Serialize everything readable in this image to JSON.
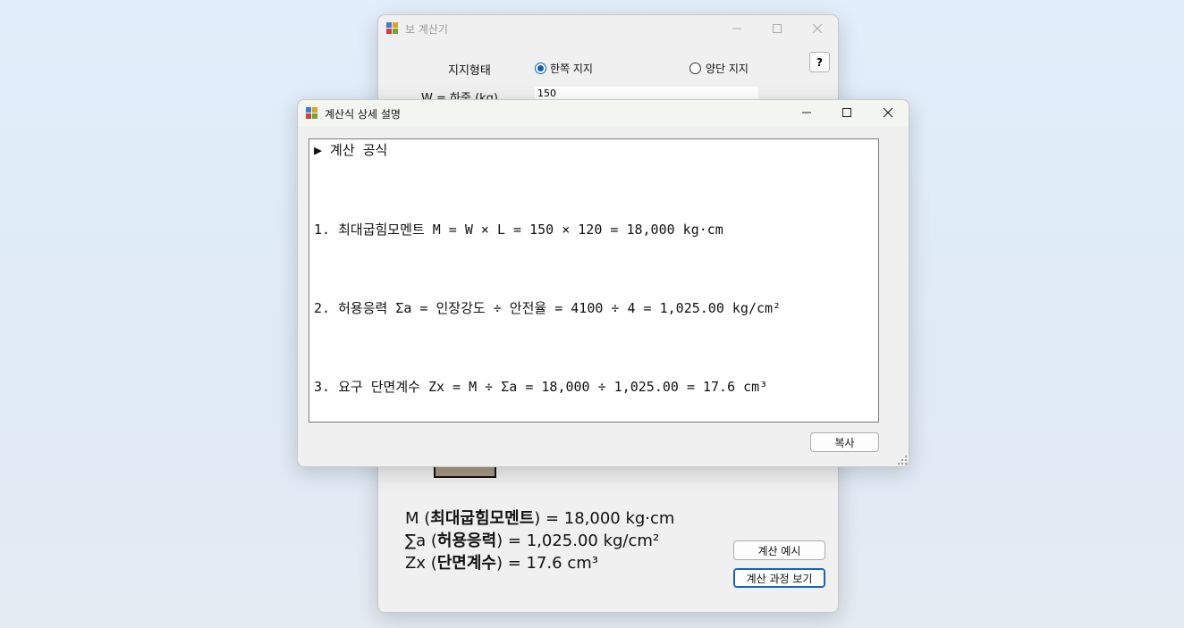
{
  "main_window": {
    "title": "보 계산기",
    "support_label": "지지형태",
    "radio_single": "한쪽 지지",
    "radio_double": "양단 지지",
    "help_label": "?",
    "load_label": "W = 하중 (kg)",
    "load_value": "150",
    "results": {
      "m_prefix": "M (",
      "m_name": "최대굽힘모멘트",
      "m_suffix": ") = 18,000 kg·cm",
      "sa_prefix": "∑a (",
      "sa_name": "허용응력",
      "sa_suffix": ") = 1,025.00 kg/cm²",
      "zx_prefix": "Zx (",
      "zx_name": "단면계수",
      "zx_suffix": ") = 17.6 cm³"
    },
    "btn_example": "계산 예시",
    "btn_process": "계산 과정 보기"
  },
  "dialog": {
    "title": "계산식 상세 설명",
    "lines": [
      "▶ 계산 공식",
      "1. 최대굽힘모멘트 M = W × L = 150 × 120 = 18,000 kg·cm",
      "2. 허용응력 Σa = 인장강도 ÷ 안전율 = 4100 ÷ 4 = 1,025.00 kg/cm²",
      "3. 요구 단면계수 Zx = M ÷ Σa = 18,000 ÷ 1,025.00 = 17.6 cm³"
    ],
    "copy_button": "복사"
  }
}
